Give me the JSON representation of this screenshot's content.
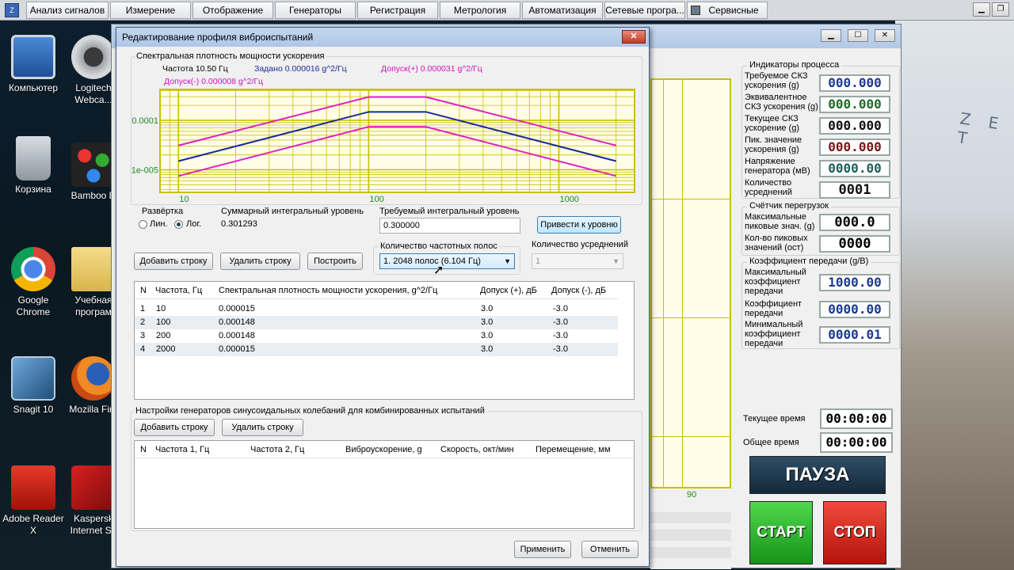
{
  "menu": {
    "items": [
      "Анализ сигналов",
      "Измерение",
      "Отображение",
      "Генераторы",
      "Регистрация",
      "Метрология",
      "Автоматизация",
      "Сетевые програ...",
      "Сервисные"
    ]
  },
  "desktop": {
    "icons": [
      {
        "label": "Компьютер"
      },
      {
        "label": "Logitech Webca..."
      },
      {
        "label": "Корзина"
      },
      {
        "label": "Bamboo D"
      },
      {
        "label": "Google Chrome"
      },
      {
        "label": "Учебная програм"
      },
      {
        "label": "Snagit 10"
      },
      {
        "label": "Mozilla Fire"
      },
      {
        "label": "Adobe Reader X"
      },
      {
        "label": "Kaspersk Internet Se"
      }
    ],
    "photo_text": "Z E T"
  },
  "background_window": {
    "graph_label": "90",
    "indicators_title": "Индикаторы процесса",
    "indicators": [
      {
        "label": "Требуемое СКЗ ускорения (g)",
        "value": "000.000",
        "color": "#1d3a8f"
      },
      {
        "label": "Эквивалентное СКЗ ускорения (g)",
        "value": "000.000",
        "color": "#1f6b2a"
      },
      {
        "label": "Текущее СКЗ ускорение (g)",
        "value": "000.000",
        "color": "#111111"
      },
      {
        "label": "Пик. значение ускорения (g)",
        "value": "000.000",
        "color": "#7a1515"
      },
      {
        "label": "Напряжение генератора (мВ)",
        "value": "0000.00",
        "color": "#1f5e5a"
      },
      {
        "label": "Количество усреднений",
        "value": "0001",
        "color": "#111111"
      }
    ],
    "overload_title": "Счётчик перегрузок",
    "overload": [
      {
        "label": "Максимальные пиковые знач. (g)",
        "value": "000.0"
      },
      {
        "label": "Кол-во пиковых значений (ост)",
        "value": "0000"
      }
    ],
    "gain_title": "Коэффициент передачи (g/В)",
    "gain": [
      {
        "label": "Максимальный коэффициент передачи",
        "value": "1000.00"
      },
      {
        "label": "Коэффициент передачи",
        "value": "0000.00"
      },
      {
        "label": "Минимальный коэффициент передачи",
        "value": "0000.01"
      }
    ],
    "current_time_label": "Текущее время",
    "current_time": "00:00:00",
    "total_time_label": "Общее время",
    "total_time": "00:00:00",
    "pause_label": "ПАУЗА",
    "start_label": "СТАРТ",
    "stop_label": "СТОП"
  },
  "dialog": {
    "title": "Редактирование профиля виброиспытаний",
    "close_glyph": "✕",
    "chart_group_title": "Спектральная плотность мощности ускорения",
    "legend": {
      "freq": "Частота   10.50 Гц",
      "set": "Задано 0.000016 g^2/Гц",
      "tol_plus": "Допуск(+) 0.000031 g^2/Гц",
      "tol_minus": "Допуск(-) 0.000008 g^2/Гц"
    },
    "sweep_title": "Развёртка",
    "sweep_lin": "Лин.",
    "sweep_log": "Лог.",
    "total_level_title": "Суммарный интегральный уровень",
    "total_level_value": "0.301293",
    "required_level_title": "Требуемый интегральный уровень",
    "required_level_value": "0.300000",
    "bring_to_level": "Привести к уровню",
    "add_row": "Добавить строку",
    "delete_row": "Удалить строку",
    "build": "Построить",
    "bands_title": "Количество частотных полос",
    "bands_value": "1. 2048 полос (6.104 Гц)",
    "averages_title": "Количество усреднений",
    "averages_value": "1",
    "profile_table": {
      "headers": [
        "N",
        "Частота, Гц",
        "Спектральная плотность мощности ускорения, g^2/Гц",
        "Допуск (+), дБ",
        "Допуск (-), дБ"
      ],
      "rows": [
        [
          "1",
          "10",
          "0.000015",
          "3.0",
          "-3.0"
        ],
        [
          "2",
          "100",
          "0.000148",
          "3.0",
          "-3.0"
        ],
        [
          "3",
          "200",
          "0.000148",
          "3.0",
          "-3.0"
        ],
        [
          "4",
          "2000",
          "0.000015",
          "3.0",
          "-3.0"
        ]
      ]
    },
    "sine_group_title": "Настройки генераторов синусоидальных колебаний для комбинированных испытаний",
    "sine_add_row": "Добавить строку",
    "sine_delete_row": "Удалить строку",
    "sine_table": {
      "headers": [
        "N",
        "Частота 1, Гц",
        "Частота 2, Гц",
        "Виброускорение, g",
        "Скорость, окт/мин",
        "Перемещение, мм"
      ]
    },
    "apply": "Применить",
    "cancel": "Отменить"
  },
  "chart_data": {
    "type": "line",
    "x_scale": "log",
    "y_scale": "log",
    "xlim": [
      8,
      2500
    ],
    "ylim": [
      3.5e-06,
      0.00042
    ],
    "x_tick_labels": [
      "10",
      "100",
      "1000"
    ],
    "y_tick_labels": [
      "1e-005",
      "0.0001"
    ],
    "grid": true,
    "series": [
      {
        "color": "#1a2a9a",
        "x": [
          10,
          100,
          200,
          2000
        ],
        "y": [
          1.5e-05,
          0.000148,
          0.000148,
          1.5e-05
        ]
      },
      {
        "color": "#e020c0",
        "x": [
          10,
          100,
          200,
          2000
        ],
        "y": [
          3.1e-05,
          0.000296,
          0.000296,
          3.1e-05
        ]
      },
      {
        "color": "#e020c0",
        "x": [
          10,
          100,
          200,
          2000
        ],
        "y": [
          7.5e-06,
          7.4e-05,
          7.4e-05,
          7.5e-06
        ]
      }
    ],
    "colors": {
      "grid": "#c7c000",
      "background": "#fffde6",
      "tick_label": "#208a20"
    }
  }
}
